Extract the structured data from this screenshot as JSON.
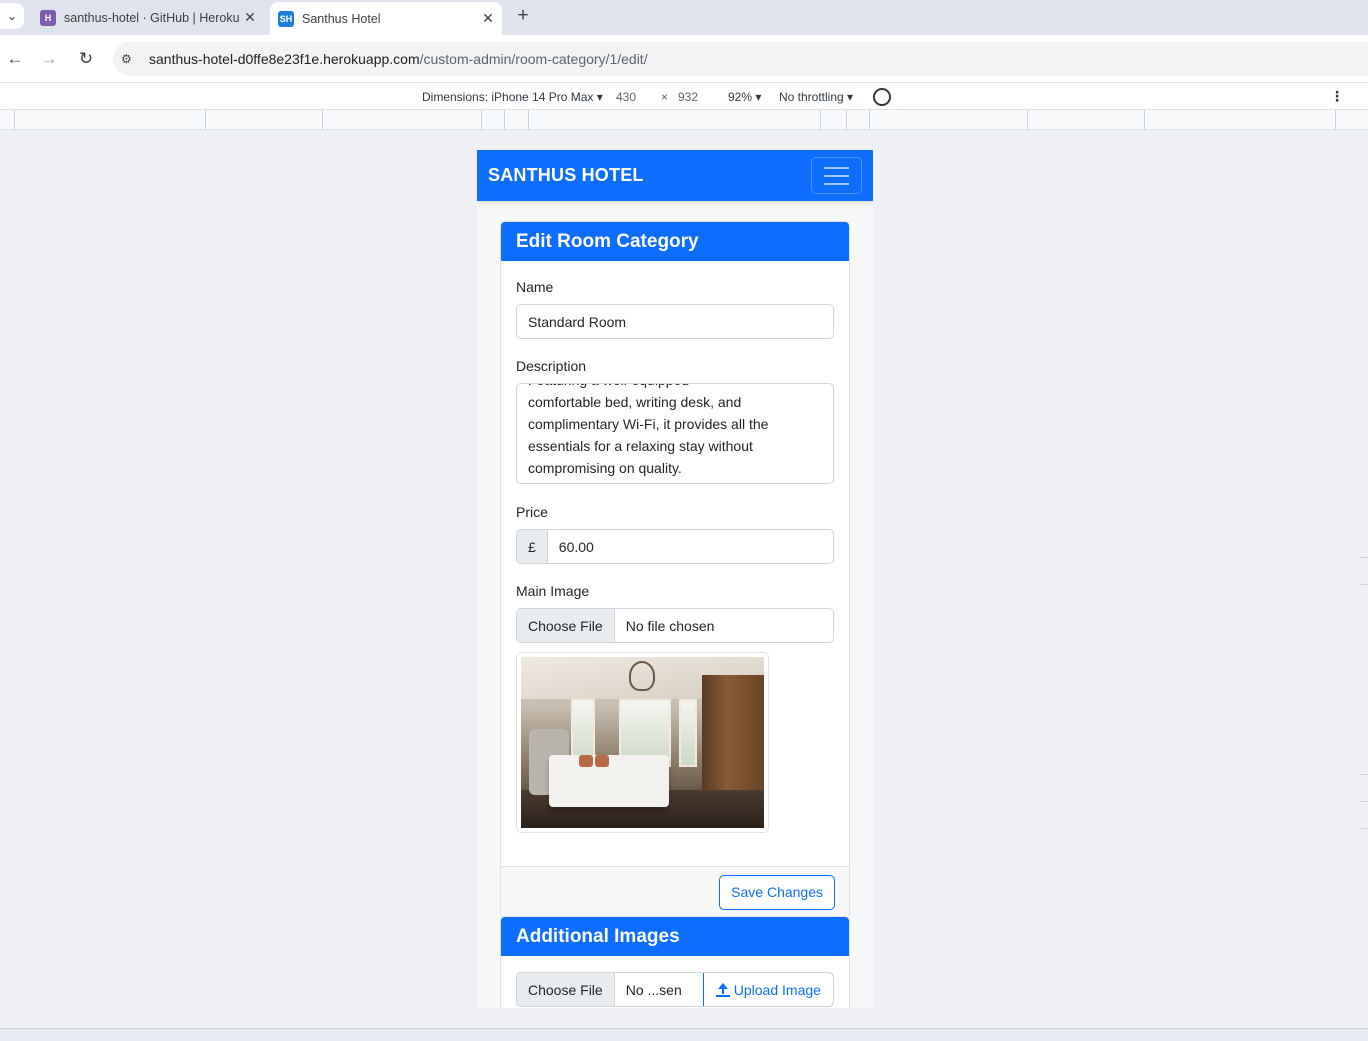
{
  "browser": {
    "tabs": [
      {
        "favicon": "heroku-icon",
        "title": "santhus-hotel · GitHub | Heroku"
      },
      {
        "favicon": "SH",
        "title": "Santhus Hotel"
      }
    ],
    "url_host": "santhus-hotel-d0ffe8e23f1e.herokuapp.com",
    "url_path": "/custom-admin/room-category/1/edit/"
  },
  "devtools": {
    "dimensions_label": "Dimensions: iPhone 14 Pro Max",
    "width": "430",
    "times": "×",
    "height": "932",
    "zoom": "92%",
    "throttling": "No throttling"
  },
  "page": {
    "brand": "SANTHUS HOTEL",
    "edit_card": {
      "title": "Edit Room Category",
      "name_label": "Name",
      "name_value": "Standard Room",
      "description_label": "Description",
      "description_lines": [
        "Featuring a well-equipped",
        "comfortable bed, writing desk, and",
        "complimentary Wi-Fi, it provides all the",
        "essentials for a relaxing stay without",
        "compromising on quality."
      ],
      "price_label": "Price",
      "currency": "£",
      "price_value": "60.00",
      "image_label": "Main Image",
      "choose_file": "Choose File",
      "no_file": "No file chosen",
      "save_label": "Save Changes"
    },
    "images_card": {
      "title": "Additional Images",
      "choose_file": "Choose File",
      "no_file": "No ...sen",
      "upload_label": "Upload Image"
    }
  },
  "colors": {
    "primary": "#0d6efd"
  }
}
